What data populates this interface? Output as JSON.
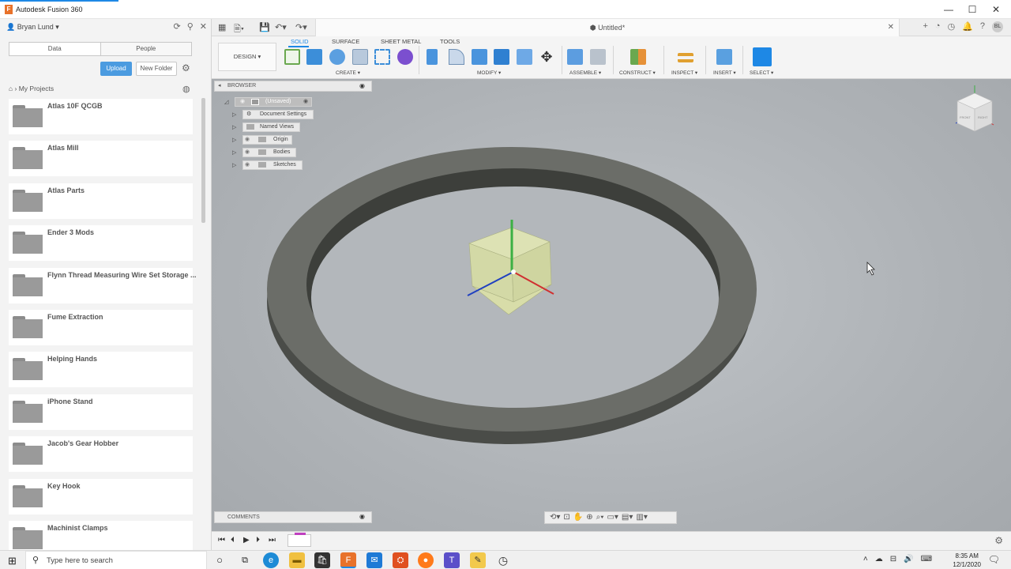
{
  "window": {
    "title": "Autodesk Fusion 360",
    "controls": [
      "—",
      "☐",
      "✕"
    ]
  },
  "data_panel": {
    "user": "Bryan Lund",
    "tabs": [
      "Data",
      "People"
    ],
    "upload": "Upload",
    "new_folder": "New Folder",
    "breadcrumb": "My Projects",
    "projects": [
      {
        "name": "Atlas 10F QCGB"
      },
      {
        "name": "Atlas Mill"
      },
      {
        "name": "Atlas Parts"
      },
      {
        "name": "Ender 3 Mods"
      },
      {
        "name": "Flynn Thread Measuring Wire Set Storage ..."
      },
      {
        "name": "Fume Extraction"
      },
      {
        "name": "Helping Hands"
      },
      {
        "name": "iPhone Stand"
      },
      {
        "name": "Jacob's Gear Hobber"
      },
      {
        "name": "Key Hook"
      },
      {
        "name": "Machinist Clamps"
      }
    ]
  },
  "document": {
    "title": "Untitled*"
  },
  "ribbon": {
    "tabs": [
      "SOLID",
      "SURFACE",
      "SHEET METAL",
      "TOOLS"
    ],
    "active_tab": "SOLID",
    "workspace": "DESIGN ▾",
    "groups": [
      "CREATE ▾",
      "MODIFY ▾",
      "ASSEMBLE ▾",
      "CONSTRUCT ▾",
      "INSPECT ▾",
      "INSERT ▾",
      "SELECT ▾"
    ]
  },
  "browser": {
    "label": "BROWSER",
    "root": "(Unsaved)",
    "nodes": [
      "Document Settings",
      "Named Views",
      "Origin",
      "Bodies",
      "Sketches"
    ]
  },
  "viewcube": {
    "faces": [
      "FRONT",
      "RIGHT"
    ]
  },
  "comments": {
    "label": "COMMENTS"
  },
  "taskbar": {
    "search_placeholder": "Type here to search",
    "time": "8:35 AM",
    "date": "12/1/2020"
  },
  "colors": {
    "accent": "#1e88e5",
    "upload_button": "#4b9be0",
    "ring": "#5a5c58",
    "origin_cube": "#d6dca8"
  }
}
